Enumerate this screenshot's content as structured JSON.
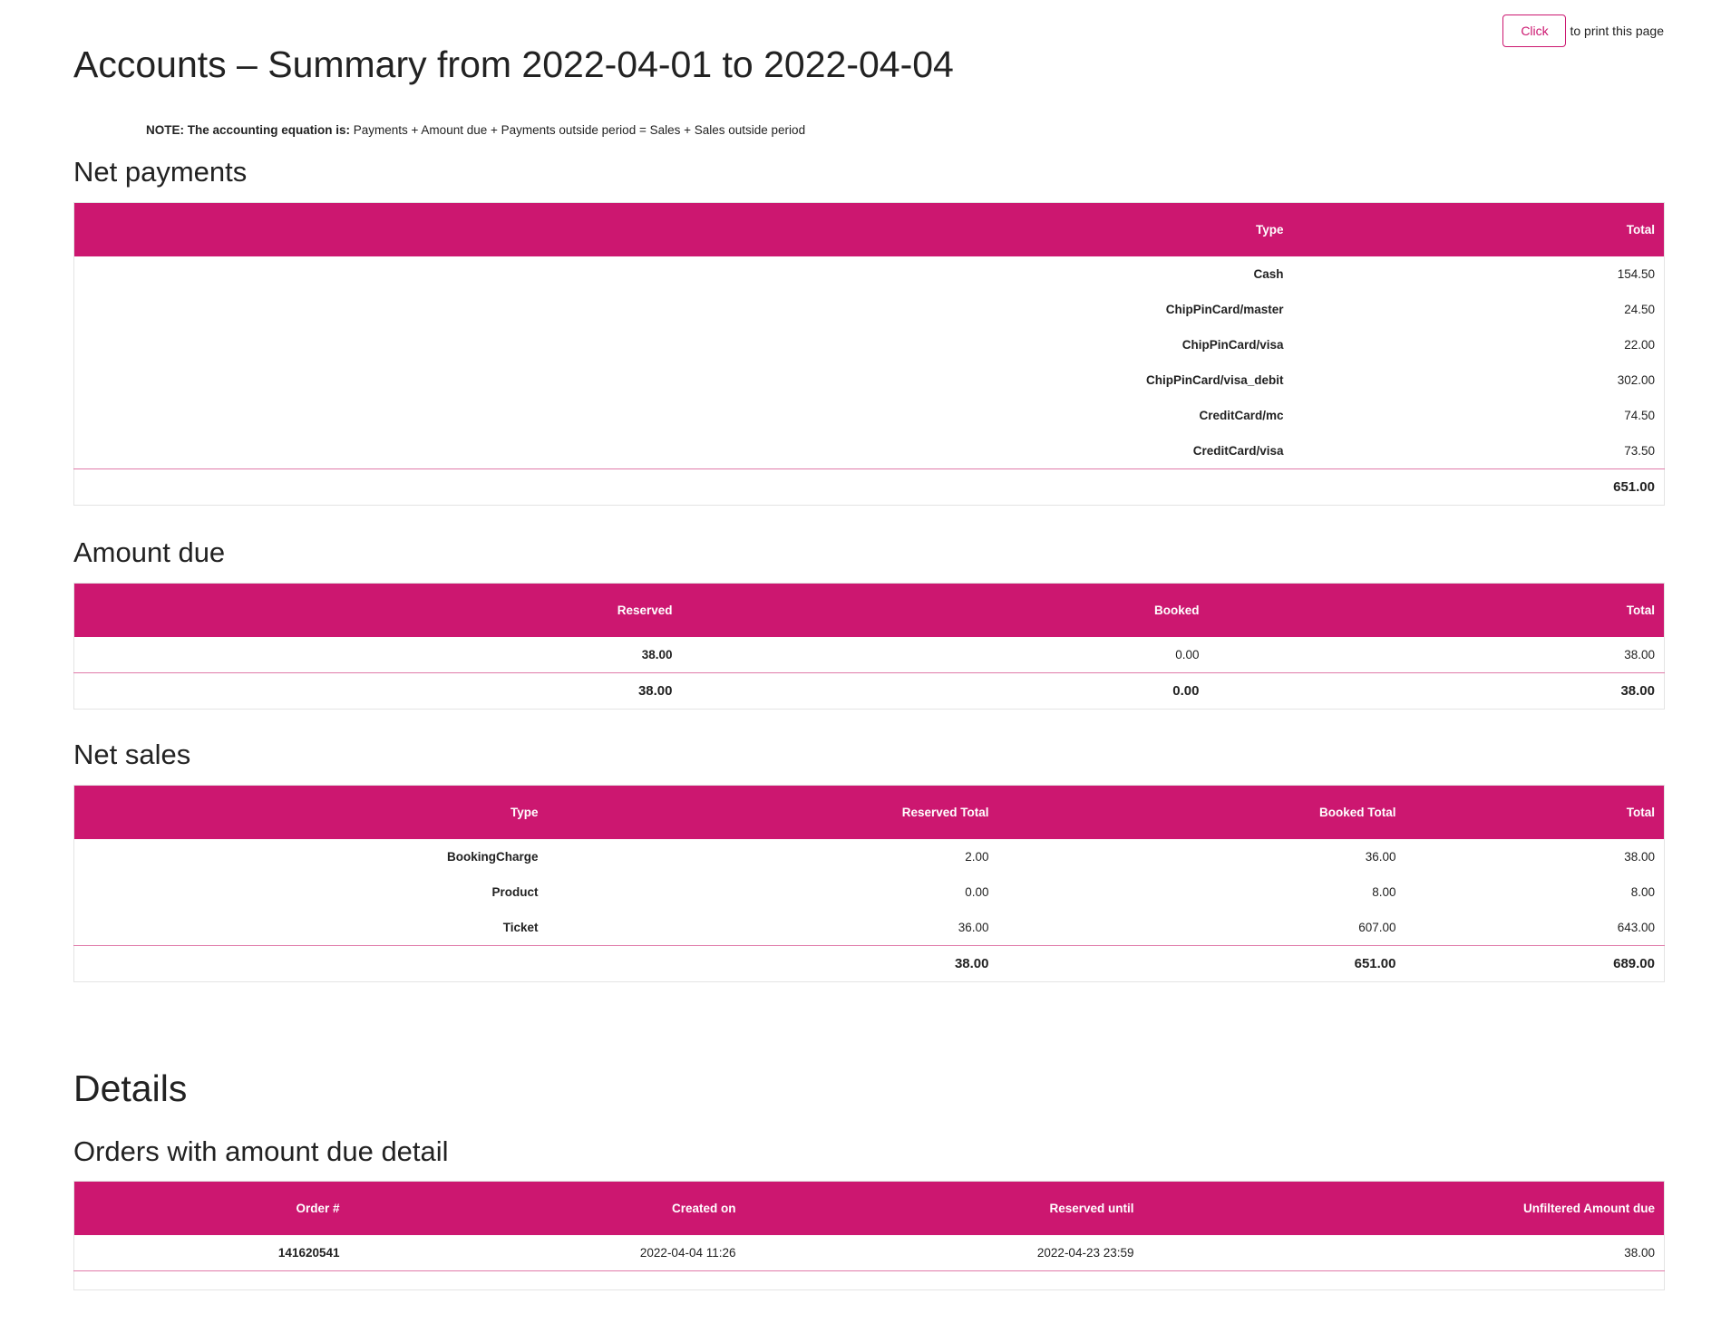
{
  "print": {
    "button_label": "Click",
    "text": "to print this page"
  },
  "title": "Accounts – Summary from 2022-04-01 to 2022-04-04",
  "note": {
    "label": "NOTE: The accounting equation is:",
    "text": " Payments + Amount due + Payments outside period = Sales + Sales outside period"
  },
  "net_payments": {
    "heading": "Net payments",
    "columns": [
      "Type",
      "Total"
    ],
    "rows": [
      {
        "type": "Cash",
        "total": "154.50"
      },
      {
        "type": "ChipPinCard/master",
        "total": "24.50"
      },
      {
        "type": "ChipPinCard/visa",
        "total": "22.00"
      },
      {
        "type": "ChipPinCard/visa_debit",
        "total": "302.00"
      },
      {
        "type": "CreditCard/mc",
        "total": "74.50"
      },
      {
        "type": "CreditCard/visa",
        "total": "73.50"
      }
    ],
    "grand_total": "651.00"
  },
  "amount_due": {
    "heading": "Amount due",
    "columns": [
      "Reserved",
      "Booked",
      "Total"
    ],
    "row": {
      "reserved": "38.00",
      "booked": "0.00",
      "total": "38.00"
    },
    "totals": {
      "reserved": "38.00",
      "booked": "0.00",
      "total": "38.00"
    }
  },
  "net_sales": {
    "heading": "Net sales",
    "columns": [
      "Type",
      "Reserved Total",
      "Booked Total",
      "Total"
    ],
    "rows": [
      {
        "type": "BookingCharge",
        "reserved": "2.00",
        "booked": "36.00",
        "total": "38.00"
      },
      {
        "type": "Product",
        "reserved": "0.00",
        "booked": "8.00",
        "total": "8.00"
      },
      {
        "type": "Ticket",
        "reserved": "36.00",
        "booked": "607.00",
        "total": "643.00"
      }
    ],
    "totals": {
      "reserved": "38.00",
      "booked": "651.00",
      "total": "689.00"
    }
  },
  "details": {
    "heading": "Details",
    "orders": {
      "heading": "Orders with amount due detail",
      "columns": [
        "Order #",
        "Created on",
        "Reserved until",
        "Unfiltered Amount due"
      ],
      "rows": [
        {
          "order": "141620541",
          "created": "2022-04-04 11:26",
          "reserved_until": "2022-04-23 23:59",
          "amount_due": "38.00"
        }
      ]
    }
  },
  "colors": {
    "accent": "#cc1770",
    "rule": "#e07aa9"
  }
}
